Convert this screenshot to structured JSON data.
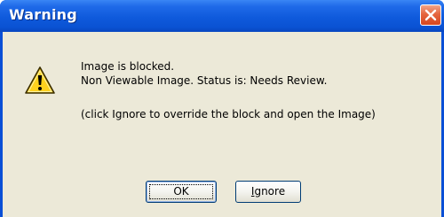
{
  "dialog": {
    "title": "Warning",
    "close_icon": "close-icon",
    "icon": "warning-icon",
    "messages": {
      "line1": "Image is blocked.",
      "line2": "Non Viewable Image.  Status is: Needs Review.",
      "line3": "(click Ignore to override the block and open the Image)"
    },
    "buttons": {
      "ok_label": "OK",
      "ignore_label": "Ignore"
    },
    "colors": {
      "titlebar": "#0a52d3",
      "close_button": "#d6461f",
      "client_bg": "#ece9d8",
      "icon_yellow": "#ffd21e"
    }
  }
}
